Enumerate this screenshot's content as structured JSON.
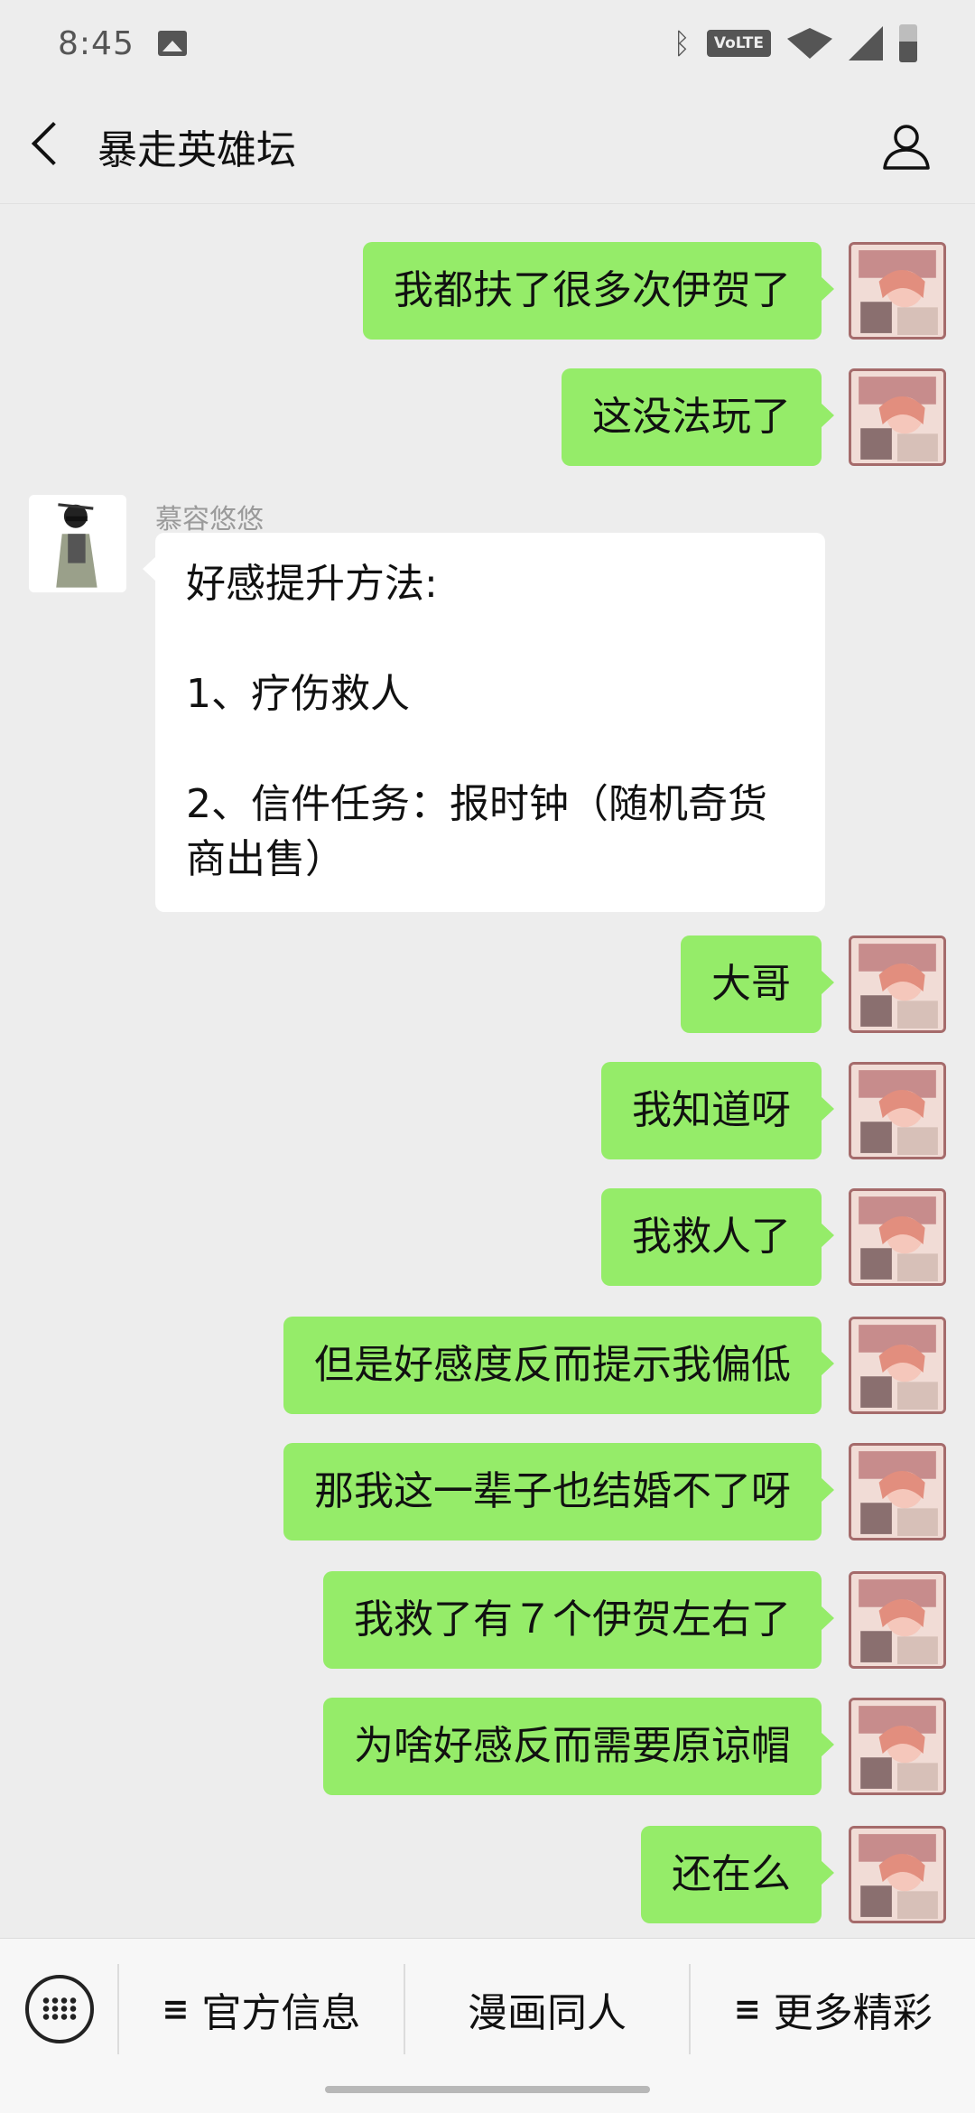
{
  "status_bar": {
    "time": "8:45",
    "icons": [
      "gallery-icon",
      "bluetooth-icon",
      "volte-icon",
      "wifi-icon",
      "signal-icon",
      "battery-icon"
    ],
    "volte_label": "VoLTE"
  },
  "header": {
    "title": "暴走英雄坛",
    "back_icon": "chevron-left-icon",
    "profile_icon": "person-icon"
  },
  "messages": [
    {
      "side": "right",
      "text": "我都扶了很多次伊贺了"
    },
    {
      "side": "right",
      "text": "这没法玩了"
    },
    {
      "side": "left",
      "sender": "慕容悠悠",
      "lines": [
        "好感提升方法:",
        "",
        "1、疗伤救人",
        "",
        "2、信件任务：报时钟（随机奇货",
        "商出售）"
      ]
    },
    {
      "side": "right",
      "text": "大哥"
    },
    {
      "side": "right",
      "text": "我知道呀"
    },
    {
      "side": "right",
      "text": "我救人了"
    },
    {
      "side": "right",
      "text": "但是好感度反而提示我偏低"
    },
    {
      "side": "right",
      "text": "那我这一辈子也结婚不了呀"
    },
    {
      "side": "right",
      "text": "我救了有７个伊贺左右了"
    },
    {
      "side": "right",
      "text": "为啥好感反而需要原谅帽"
    },
    {
      "side": "right",
      "text": "还在么"
    }
  ],
  "bottom_menu": {
    "keyboard_icon": "keyboard-icon",
    "items": [
      {
        "label": "官方信息",
        "has_submenu": true
      },
      {
        "label": "漫画同人",
        "has_submenu": false
      },
      {
        "label": "更多精彩",
        "has_submenu": true
      }
    ],
    "submenu_glyph": "≡"
  },
  "colors": {
    "self_bubble": "#95ec69",
    "other_bubble": "#ffffff",
    "background": "#ededed"
  }
}
